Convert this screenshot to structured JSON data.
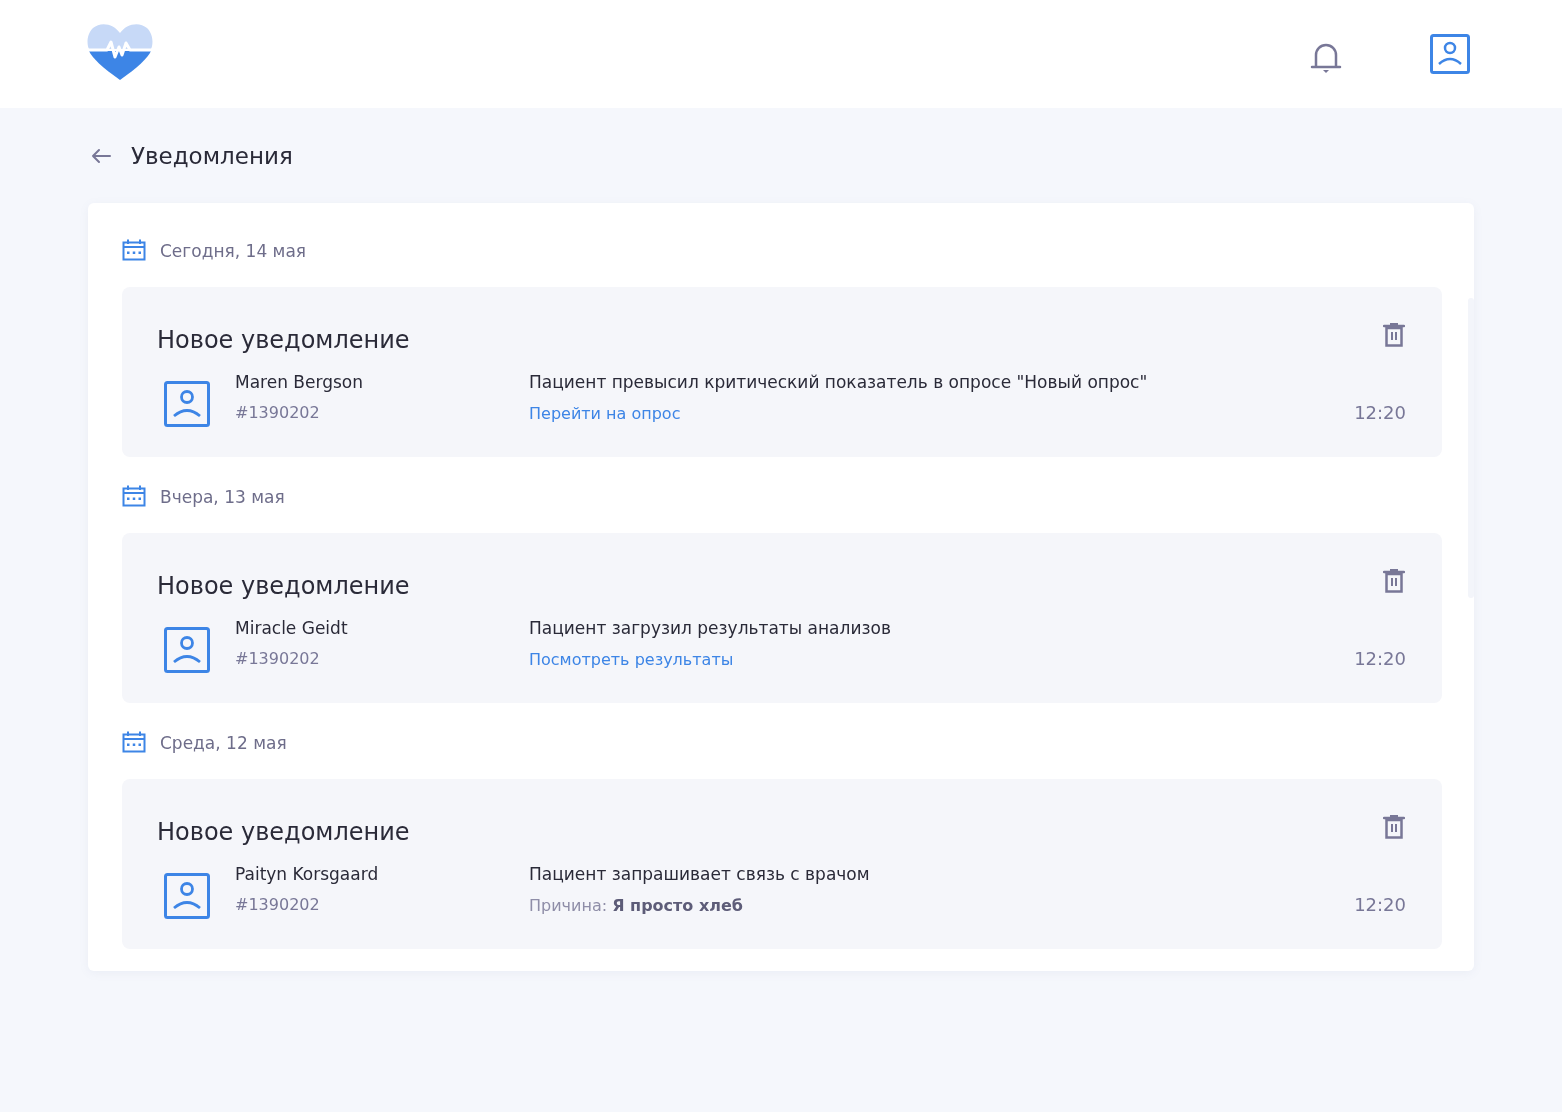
{
  "page": {
    "title": "Уведомления"
  },
  "groups": [
    {
      "date": "Сегодня, 14 мая",
      "items": [
        {
          "title": "Новое уведомление",
          "patient": "Maren Bergson",
          "patient_id": "#1390202",
          "message": "Пациент превысил критический показатель в опросе \"Новый опрос\"",
          "detail": {
            "kind": "link",
            "text": "Перейти на опрос"
          },
          "time": "12:20"
        }
      ]
    },
    {
      "date": "Вчера, 13 мая",
      "items": [
        {
          "title": "Новое уведомление",
          "patient": "Miracle Geidt",
          "patient_id": "#1390202",
          "message": "Пациент загрузил результаты анализов",
          "detail": {
            "kind": "link",
            "text": "Посмотреть результаты"
          },
          "time": "12:20"
        }
      ]
    },
    {
      "date": "Среда, 12 мая",
      "items": [
        {
          "title": "Новое уведомление",
          "patient": "Paityn Korsgaard",
          "patient_id": "#1390202",
          "message": "Пациент запрашивает связь с врачом",
          "detail": {
            "kind": "reason",
            "text": "Причина: **Я просто хлеб**"
          },
          "time": "12:20"
        }
      ]
    }
  ]
}
